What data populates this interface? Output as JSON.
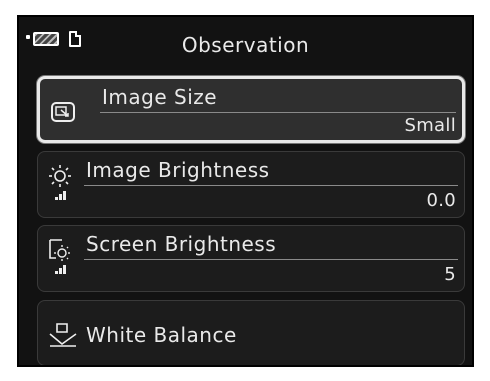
{
  "header": {
    "title": "Observation"
  },
  "menu": {
    "items": [
      {
        "label": "Image Size",
        "value": "Small",
        "icon": "image-size-icon"
      },
      {
        "label": "Image Brightness",
        "value": "0.0",
        "icon": "image-brightness-icon"
      },
      {
        "label": "Screen Brightness",
        "value": "5",
        "icon": "screen-brightness-icon"
      },
      {
        "label": "White Balance",
        "icon": "white-balance-icon"
      }
    ]
  }
}
